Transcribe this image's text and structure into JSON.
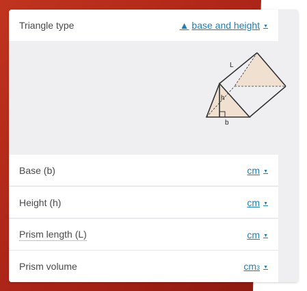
{
  "triangle_type": {
    "label": "Triangle type",
    "value": "base and height",
    "glyph": "▲"
  },
  "figure": {
    "L": "L",
    "h": "h",
    "b": "b"
  },
  "fields": [
    {
      "label": "Base (b)",
      "unit": "cm"
    },
    {
      "label": "Height (h)",
      "unit": "cm"
    },
    {
      "label": "Prism length (L)",
      "unit": "cm"
    },
    {
      "label": "Prism volume",
      "unit": "cm",
      "unit_sup": "3"
    }
  ],
  "colors": {
    "accent": "#1d7fb8",
    "background_red": "#b5271b",
    "panel": "#efeff1"
  }
}
